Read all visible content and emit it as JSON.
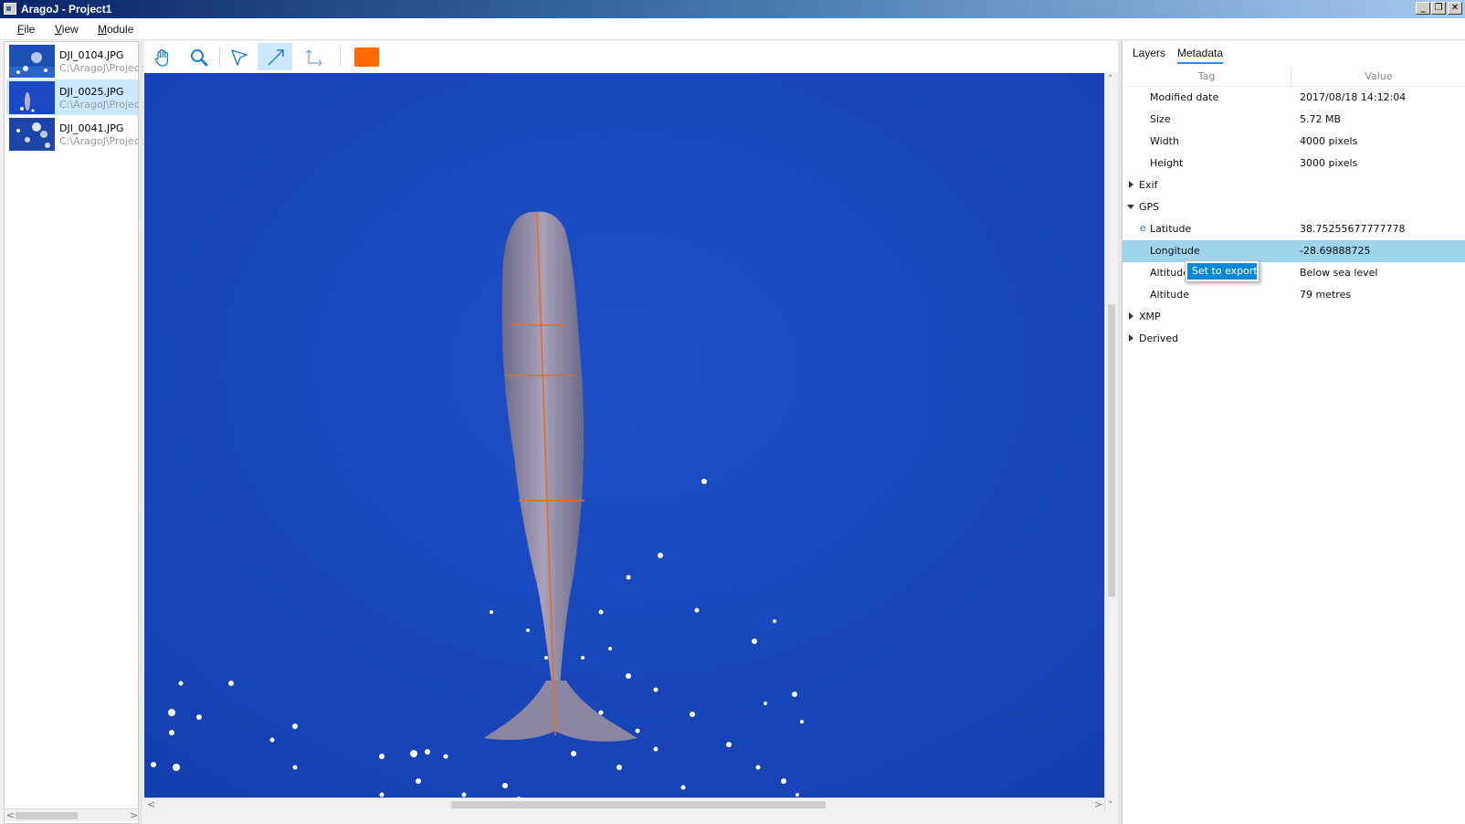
{
  "window": {
    "title": "AragoJ - Project1",
    "minimize_icon": "minimize-icon",
    "restore_icon": "restore-icon",
    "close_icon": "close-icon"
  },
  "menubar": {
    "items": [
      {
        "first": "F",
        "rest": "ile"
      },
      {
        "first": "V",
        "rest": "iew"
      },
      {
        "first": "M",
        "rest": "odule"
      }
    ]
  },
  "files": [
    {
      "name": "DJI_0104.JPG",
      "path": "C:\\AragoJ\\Project"
    },
    {
      "name": "DJI_0025.JPG",
      "path": "C:\\AragoJ\\Project",
      "selected": true
    },
    {
      "name": "DJI_0041.JPG",
      "path": "C:\\AragoJ\\Project"
    }
  ],
  "toolbar": {
    "tools": [
      "hand-icon",
      "zoom-icon",
      "select-arrow-icon",
      "measure-line-icon",
      "angle-icon"
    ],
    "active_tool": "measure-line-icon",
    "color": "#ff6a00"
  },
  "panel": {
    "tabs": [
      "Layers",
      "Metadata"
    ],
    "active_tab": "Metadata",
    "columns": {
      "tag": "Tag",
      "value": "Value"
    },
    "rows": [
      {
        "tag": "Modified date",
        "value": "2017/08/18 14:12:04"
      },
      {
        "tag": "Size",
        "value": "5.72 MB"
      },
      {
        "tag": "Width",
        "value": "4000 pixels"
      },
      {
        "tag": "Height",
        "value": "3000 pixels"
      },
      {
        "tag": "Exif",
        "group": "collapsed"
      },
      {
        "tag": "GPS",
        "group": "expanded"
      },
      {
        "tag": "Latitude",
        "value": "38.75255677777778",
        "export_marker": "e"
      },
      {
        "tag": "Longitude",
        "value": "-28.69888725",
        "selected": true
      },
      {
        "tag": "Altitude",
        "value": "Below sea level"
      },
      {
        "tag": "Altitude",
        "value": "79 metres"
      },
      {
        "tag": "XMP",
        "group": "collapsed"
      },
      {
        "tag": "Derived",
        "group": "collapsed"
      }
    ],
    "context_menu": {
      "item": "Set to export"
    }
  }
}
